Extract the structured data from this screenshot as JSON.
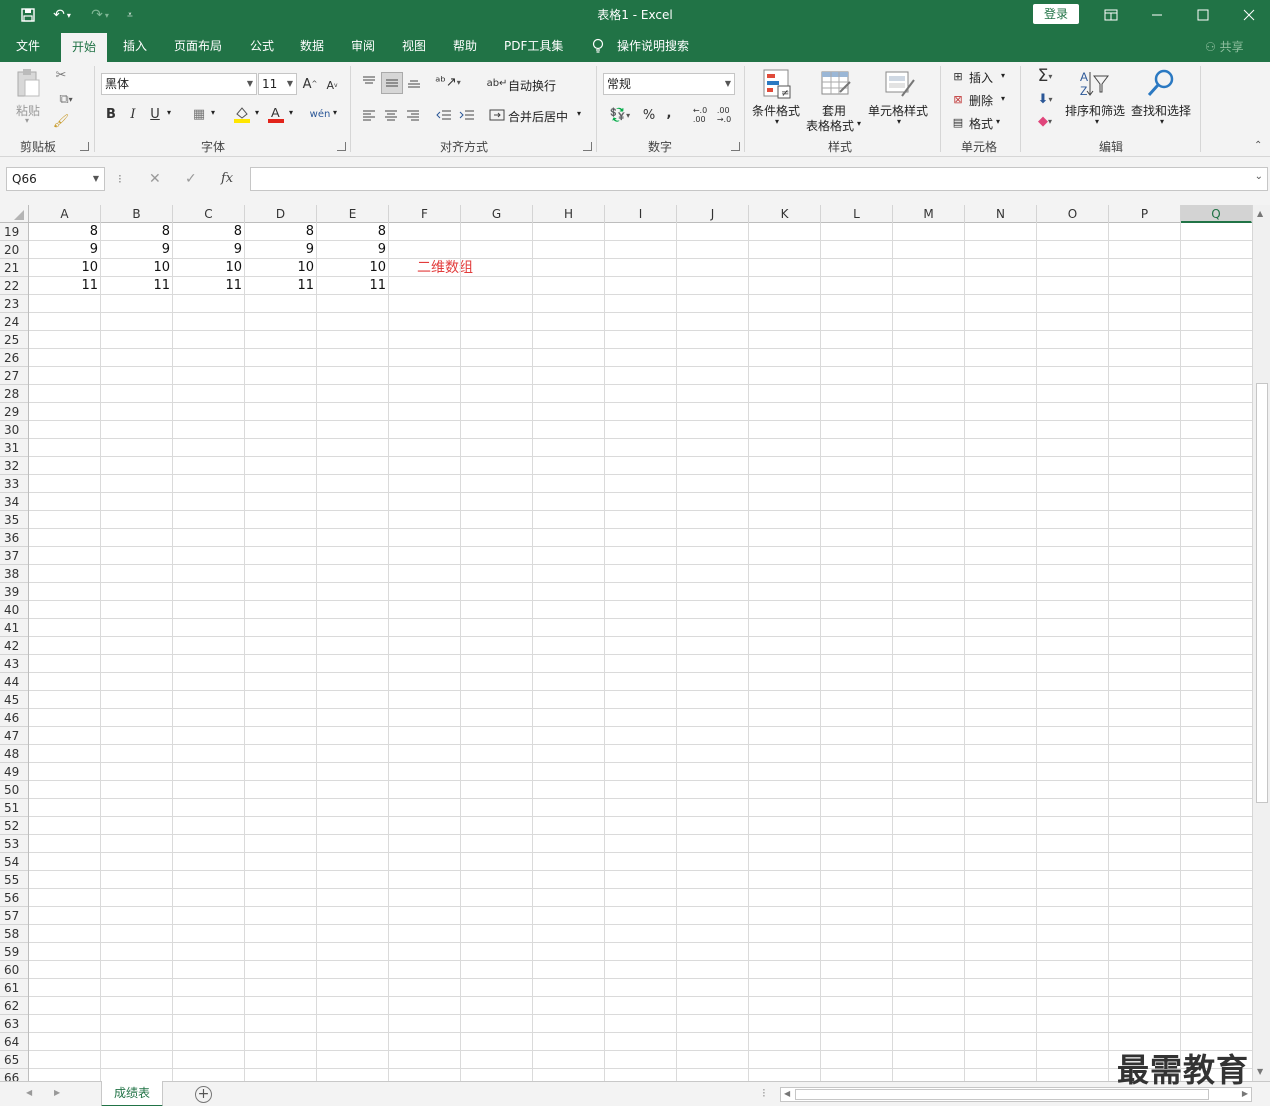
{
  "window": {
    "title": "表格1  -  Excel",
    "login_label": "登录"
  },
  "menu": {
    "tabs": [
      "文件",
      "开始",
      "插入",
      "页面布局",
      "公式",
      "数据",
      "审阅",
      "视图",
      "帮助",
      "PDF工具集"
    ],
    "active_tab": "开始",
    "tell_me": "操作说明搜索",
    "share": "共享"
  },
  "ribbon": {
    "clipboard": {
      "label": "剪贴板",
      "paste": "粘贴"
    },
    "font": {
      "label": "字体",
      "name": "黑体",
      "size": "11",
      "bold": "B",
      "italic": "I",
      "underline": "U"
    },
    "alignment": {
      "label": "对齐方式",
      "wrap_text": "自动换行",
      "merge_center": "合并后居中"
    },
    "number": {
      "label": "数字",
      "format": "常规",
      "percent": "%",
      "comma": ","
    },
    "styles": {
      "label": "样式",
      "conditional_format": "条件格式",
      "format_as_table_1": "套用",
      "format_as_table_2": "表格格式",
      "cell_styles": "单元格样式"
    },
    "cells": {
      "label": "单元格",
      "insert": "插入",
      "delete": "删除",
      "format": "格式"
    },
    "editing": {
      "label": "编辑",
      "sort_filter": "排序和筛选",
      "find_select": "查找和选择"
    }
  },
  "formula_bar": {
    "name_box": "Q66",
    "fx": "fx",
    "formula": ""
  },
  "grid": {
    "columns": [
      "A",
      "B",
      "C",
      "D",
      "E",
      "F",
      "G",
      "H",
      "I",
      "J",
      "K",
      "L",
      "M",
      "N",
      "O",
      "P",
      "Q"
    ],
    "selected_column": "Q",
    "first_row": 19,
    "last_row": 66,
    "data_rows": [
      {
        "row": 19,
        "values": [
          "8",
          "8",
          "8",
          "8",
          "8"
        ]
      },
      {
        "row": 20,
        "values": [
          "9",
          "9",
          "9",
          "9",
          "9"
        ]
      },
      {
        "row": 21,
        "values": [
          "10",
          "10",
          "10",
          "10",
          "10"
        ]
      },
      {
        "row": 22,
        "values": [
          "11",
          "11",
          "11",
          "11",
          "11"
        ]
      }
    ],
    "note": {
      "text": "二维数组",
      "cell": "F21",
      "color": "#e23c3c"
    }
  },
  "sheets": {
    "tabs": [
      "成绩表"
    ],
    "active": "成绩表"
  },
  "watermark": "最需教育",
  "colors": {
    "accent": "#217346"
  }
}
